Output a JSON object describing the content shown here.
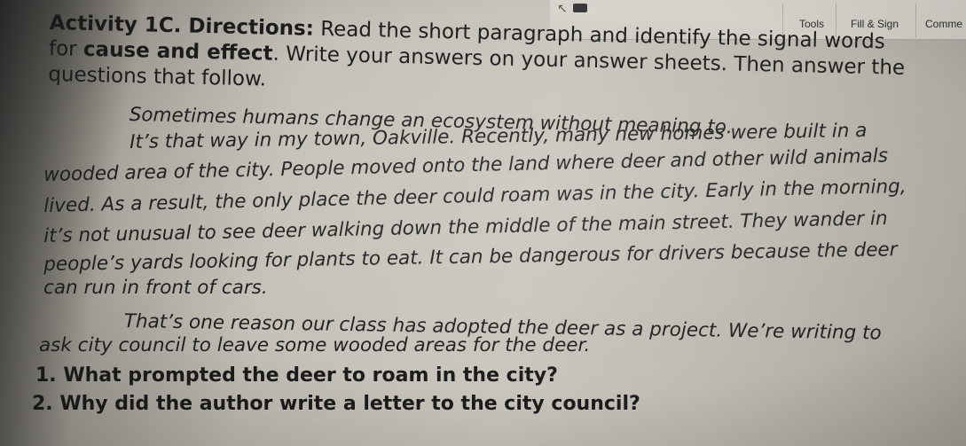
{
  "toolbar": {
    "tools_label": "Tools",
    "fill_sign_label": "Fill & Sign",
    "comment_label": "Comme"
  },
  "activity": {
    "title": "Activity 1C. Directions:",
    "instruction_pre": " Read the short paragraph and identify the signal words for ",
    "instruction_bold": "cause and effect",
    "instruction_post": ". Write your answers on your answer sheets.  Then answer the questions that follow."
  },
  "passage": {
    "lines": [
      "Sometimes humans change an ecosystem without meaning to.",
      "It’s that way in my town, Oakville. Recently, many new homes were built in a",
      "wooded area of the city. People moved onto the land where deer and other wild animals",
      "lived. As a result, the only place the deer could roam was in the city. Early in the morning,",
      "it’s not unusual to see deer walking down the middle of the main street. They wander in",
      "people’s yards looking for plants to eat. It can be dangerous for drivers because the deer",
      "can run in front of cars.",
      "That’s one reason our class has adopted the deer as a project. We’re writing to",
      "ask city council to leave some wooded areas for the deer."
    ]
  },
  "questions": [
    "1. What prompted the deer to roam in the city?",
    "2. Why did the author write a letter to the city council?"
  ]
}
